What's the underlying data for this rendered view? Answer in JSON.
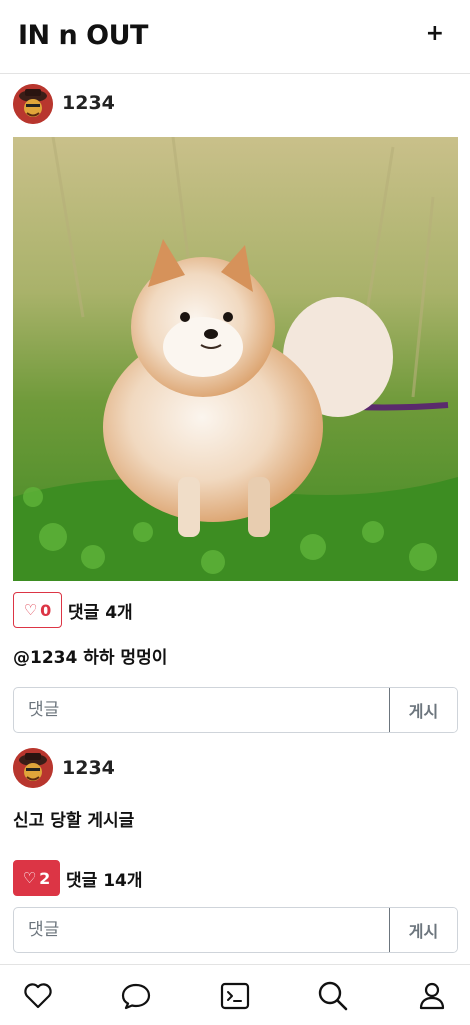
{
  "header": {
    "title": "IN n OUT",
    "add_label": "+"
  },
  "posts": [
    {
      "username": "1234",
      "likes": "0",
      "comment_count_label": "댓글 4개",
      "text": "@1234 하하 멍멍이",
      "comment_placeholder": "댓글",
      "submit_label": "게시",
      "liked": false
    },
    {
      "username": "1234",
      "likes": "2",
      "comment_count_label": "댓글 14개",
      "text": "신고 당할 게시글",
      "comment_placeholder": "댓글",
      "submit_label": "게시",
      "liked": true
    }
  ],
  "nav": {
    "items": [
      {
        "icon": "heart-icon"
      },
      {
        "icon": "chat-icon"
      },
      {
        "icon": "terminal-icon"
      },
      {
        "icon": "search-icon"
      },
      {
        "icon": "user-icon"
      }
    ]
  },
  "colors": {
    "like": "#dc3545",
    "border": "#cfd4da",
    "muted": "#6c757d"
  }
}
